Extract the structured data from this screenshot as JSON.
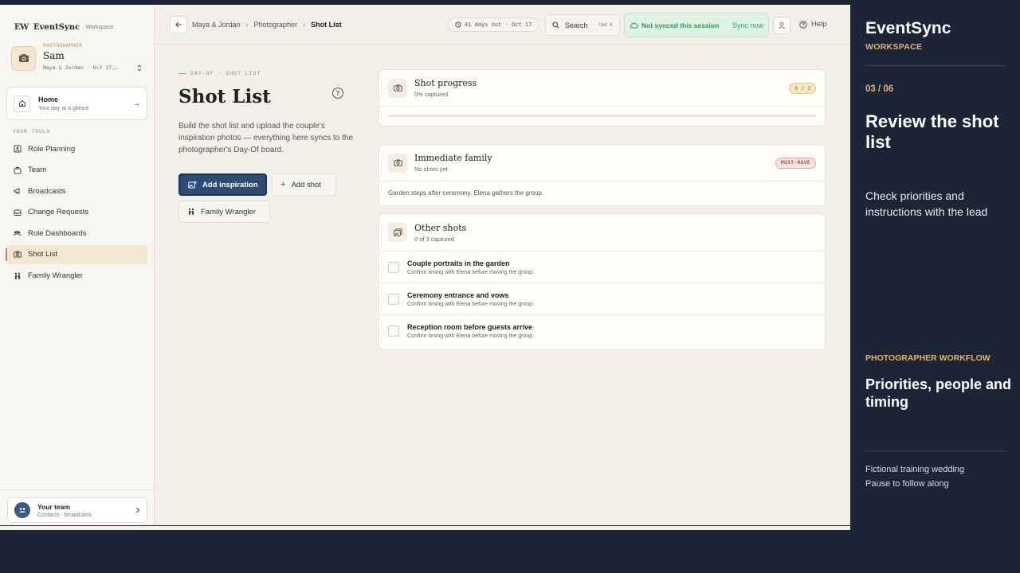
{
  "brand": {
    "logo": "EW",
    "name": "EventSync",
    "sub": "· Workspace"
  },
  "profile": {
    "role": "PHOTOGRAPHER",
    "name": "Sam",
    "meta": "Maya & Jordan · Oct 17,…"
  },
  "home": {
    "title": "Home",
    "subtitle": "Your day at a glance"
  },
  "tools_label": "YOUR TOOLS",
  "nav": [
    {
      "label": "Role Planning",
      "icon": "role-planning-icon"
    },
    {
      "label": "Team",
      "icon": "team-icon"
    },
    {
      "label": "Broadcasts",
      "icon": "megaphone-icon"
    },
    {
      "label": "Change Requests",
      "icon": "inbox-icon"
    },
    {
      "label": "Role Dashboards",
      "icon": "people-icon"
    },
    {
      "label": "Shot List",
      "icon": "camera-icon",
      "active": true
    },
    {
      "label": "Family Wrangler",
      "icon": "family-icon"
    }
  ],
  "team_card": {
    "title": "Your team",
    "subtitle": "Contacts · broadcasts"
  },
  "breadcrumb": {
    "items": [
      "Maya & Jordan",
      "Photographer"
    ],
    "current": "Shot List"
  },
  "topbar": {
    "days_out": "41 days out · Oct 17",
    "search_label": "Search",
    "search_kbd": "Cmd K",
    "sync_status": "Not synced this session",
    "sync_action": "Sync now",
    "help": "Help"
  },
  "page": {
    "kicker": "DAY-OF · SHOT LIST",
    "title": "Shot List",
    "description": "Build the shot list and upload the couple's inspiration photos — everything here syncs to the photographer's Day-Of board.",
    "add_inspiration": "Add inspiration",
    "add_shot": "Add shot",
    "family_wrangler": "Family Wrangler"
  },
  "progress_card": {
    "title": "Shot progress",
    "subtitle": "0% captured",
    "count": "0 / 3",
    "fraction": 0
  },
  "family_card": {
    "title": "Immediate family",
    "subtitle": "No shots yet",
    "badge": "MUST-HAVE",
    "note": "Garden steps after ceremony. Elena gathers the group."
  },
  "other_card": {
    "title": "Other shots",
    "subtitle": "0 of 3 captured",
    "shots": [
      {
        "title": "Couple portraits in the garden",
        "note": "Confirm timing with Elena before moving the group."
      },
      {
        "title": "Ceremony entrance and vows",
        "note": "Confirm timing with Elena before moving the group."
      },
      {
        "title": "Reception room before guests arrive",
        "note": "Confirm timing with Elena before moving the group."
      }
    ]
  },
  "panel": {
    "brand": "EventSync",
    "sub": "WORKSPACE",
    "step": "03 / 06",
    "heading": "Review the shot list",
    "body": "Check priorities and instructions with the lead",
    "workflow_label": "PHOTOGRAPHER WORKFLOW",
    "workflow_title": "Priorities, people and timing",
    "footer1": "Fictional training wedding",
    "footer2": "Pause to follow along"
  },
  "colors": {
    "accent": "#b08a52",
    "primary": "#2e4a75",
    "panel_bg": "#1b2536",
    "sync_green": "#2f9a52",
    "must_red": "#b0463c"
  }
}
